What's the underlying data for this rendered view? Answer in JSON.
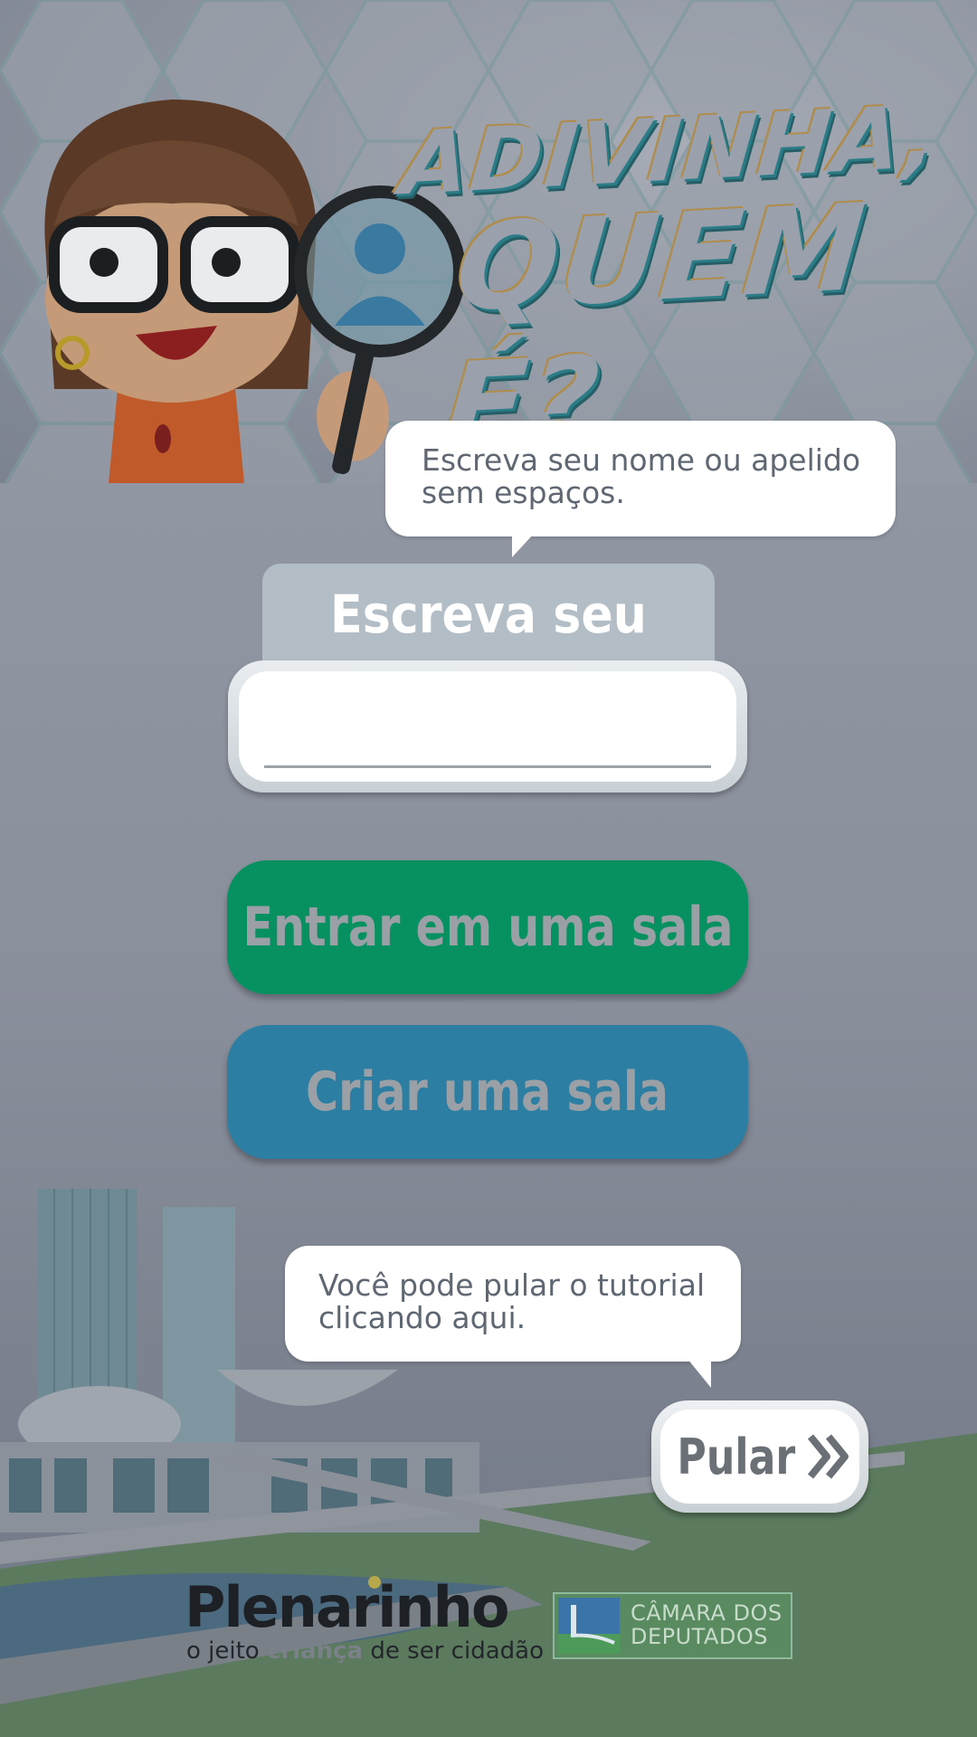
{
  "game": {
    "title_line1": "ADIVINHA,",
    "title_line2": "QUEM É?"
  },
  "tutorial": {
    "name_hint": "Escreva seu nome ou apelido sem espaços.",
    "skip_hint": "Você pode pular o tutorial clicando aqui."
  },
  "name_form": {
    "label": "Escreva seu nome",
    "value": "",
    "placeholder": ""
  },
  "actions": {
    "enter_room": "Entrar em uma sala",
    "create_room": "Criar uma sala",
    "skip": "Pular"
  },
  "footer": {
    "plenarinho_logo": "Plenarinho",
    "plenarinho_tagline_pre": "o jeito ",
    "plenarinho_tagline_highlight": "criança",
    "plenarinho_tagline_post": " de ser cidadão",
    "camara_logo": "CÂMARA DOS DEPUTADOS"
  },
  "icons": {
    "skip": "double-chevron-right-icon",
    "magnifier": "magnifying-glass-icon"
  },
  "colors": {
    "enter_button": "#079060",
    "create_button": "#2c7fa2",
    "overlay_gray": "#8f939f"
  }
}
